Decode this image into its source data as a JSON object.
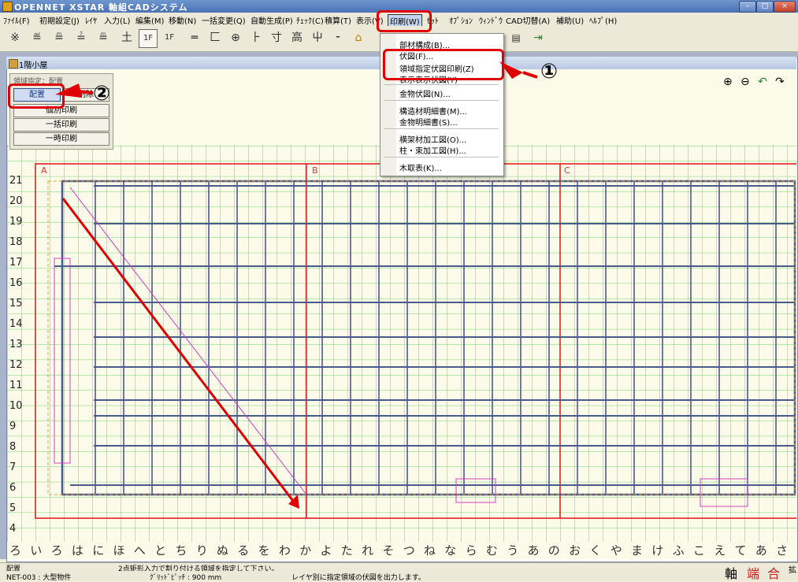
{
  "window": {
    "title": "OPENNET XSTAR 軸組CADシステム",
    "controls": [
      "–",
      "□",
      "×"
    ]
  },
  "menu": [
    "ﾌｧｲﾙ(F)",
    "初期設定(J)",
    "ﾚｲﾔ",
    "入力(L)",
    "編集(M)",
    "移動(N)",
    "一括変更(Q)",
    "自動生成(P)",
    "ﾁｪｯｸ(C)",
    "積算(T)",
    "表示(V)",
    "印刷(W)",
    "ｾｯﾄ",
    "ｵﾌﾟｼｮﾝ",
    "ｳｨﾝﾄﾞｳ",
    "CAD切替(A)",
    "補助(U)",
    "ﾍﾙﾌﾟ(H)"
  ],
  "toolbar_glyphs": [
    "※",
    "≝",
    "≞",
    "≟",
    "≞",
    "土",
    "1F",
    "1F",
    "═",
    "匚",
    "⊕",
    "⺊",
    "寸",
    "高",
    "⼬",
    "⁃",
    "⌂"
  ],
  "child_window": {
    "title": "1階小屋",
    "controls": [
      "–",
      "□",
      "×"
    ]
  },
  "panel": {
    "header": "領域指定：配置",
    "buttons": [
      "配置",
      "削除",
      "個別印刷",
      "一括印刷",
      "一時印刷"
    ]
  },
  "dropdown": {
    "items": [
      "部材構成(B)...",
      "伏図(F)...",
      "領域指定伏図印刷(Z)",
      "表示表示伏図(Y)",
      "金物伏図(N)...",
      "構造材明細書(M)...",
      "金物明細書(S)...",
      "横架材加工図(O)...",
      "柱・束加工図(H)...",
      "木取表(K)..."
    ]
  },
  "annotations": {
    "callout1": "①",
    "callout2": "②"
  },
  "grid": {
    "row_labels": [
      "21",
      "20",
      "19",
      "18",
      "17",
      "16",
      "15",
      "14",
      "13",
      "12",
      "11",
      "10",
      "9",
      "8",
      "7",
      "6",
      "5",
      "4"
    ],
    "column_labels": [
      "ろ",
      "い",
      "ろ",
      "は",
      "に",
      "ほ",
      "へ",
      "と",
      "ち",
      "り",
      "ぬ",
      "る",
      "を",
      "わ",
      "か",
      "よ",
      "た",
      "れ",
      "そ",
      "つ",
      "ね",
      "な",
      "ら",
      "む",
      "う",
      "あ",
      "の",
      "お",
      "く",
      "や",
      "ま",
      "け",
      "ふ",
      "こ",
      "え",
      "て",
      "あ",
      "さ"
    ],
    "axis_marks": [
      "A",
      "B",
      "C"
    ]
  },
  "status": {
    "mode": "配置",
    "prompt": "2点矩形入力で割り付ける領域を指定して下さい。",
    "project": "NET-003 : 大型物件",
    "grid_info": "ｸﾞﾘｯﾄﾞﾋﾟｯﾁ : 900 mm",
    "hint": "レイヤ別に指定領域の伏図を出力します。",
    "buttons": [
      "軸",
      "端",
      "合",
      "拡"
    ]
  },
  "colors": {
    "title_bar": "#4a72b4",
    "canvas_bg": "#fcfbea",
    "grid_line": "#4cc24c",
    "beam_line": "#4a5a8a",
    "axis_line": "#e02020",
    "annotation_red": "#e00000"
  }
}
